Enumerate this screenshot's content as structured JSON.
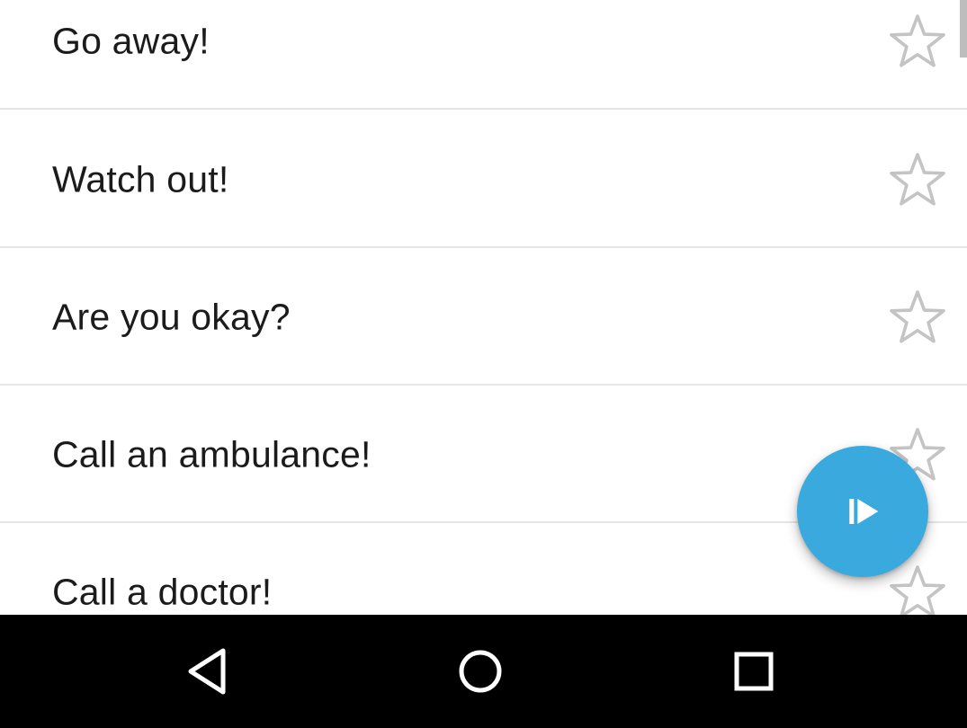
{
  "phrases": {
    "items": [
      {
        "label": "Go away!",
        "starred": false
      },
      {
        "label": "Watch out!",
        "starred": false
      },
      {
        "label": "Are you okay?",
        "starred": false
      },
      {
        "label": "Call an ambulance!",
        "starred": false
      },
      {
        "label": "Call a doctor!",
        "starred": false
      }
    ],
    "star_icon": "star-outline-icon",
    "star_color": "#c4c4c4",
    "divider_color": "#e6e6e6"
  },
  "fab": {
    "icon": "play-step-icon",
    "color": "#3aa9dd"
  },
  "navigation_bar": {
    "back_icon": "back-triangle-icon",
    "home_icon": "home-circle-icon",
    "recents_icon": "recents-square-icon",
    "background": "#000000"
  }
}
